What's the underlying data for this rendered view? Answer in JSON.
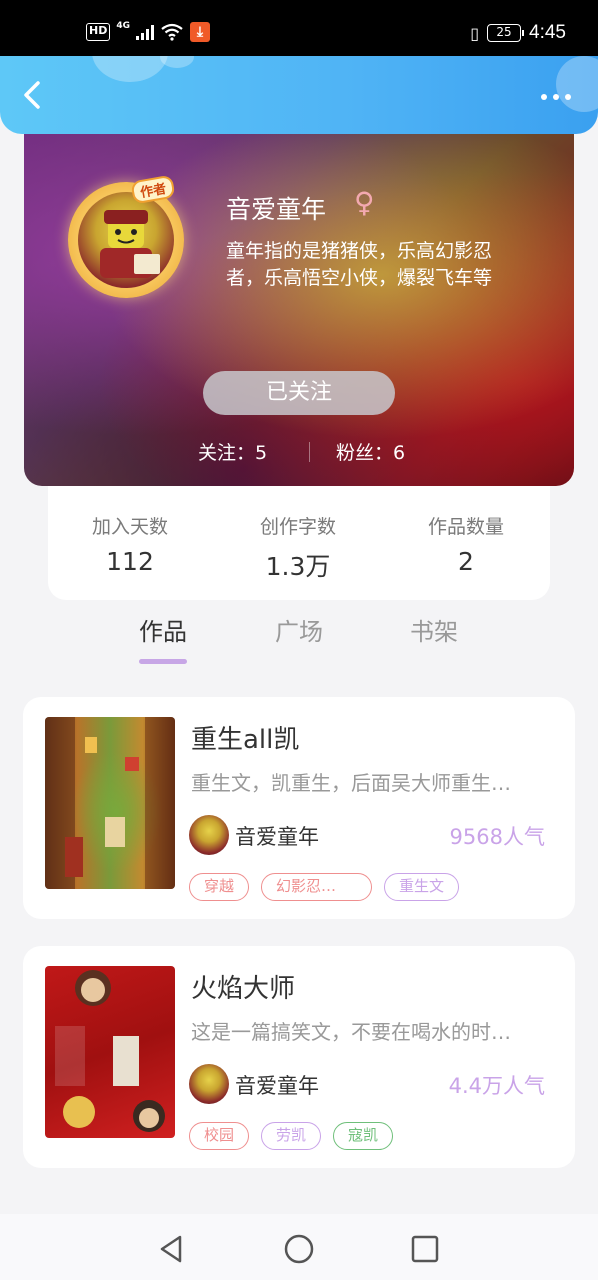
{
  "status_bar": {
    "hd": "HD",
    "network": "4G",
    "battery": "25",
    "time": "4:45",
    "icons": [
      "hd-icon",
      "signal-icon",
      "wifi-icon",
      "download-icon",
      "vibrate-icon",
      "battery-icon"
    ]
  },
  "header": {
    "back_icon": "back-arrow-icon",
    "more_icon": "more-dots-icon"
  },
  "profile": {
    "author_badge": "作者",
    "name": "音爱童年",
    "gender_symbol": "♀",
    "bio": "童年指的是猪猪侠，乐高幻影忍者，乐高悟空小侠，爆裂飞车等",
    "follow_button": "已关注",
    "following_label": "关注：",
    "following_count": "5",
    "fans_label": "粉丝：",
    "fans_count": "6"
  },
  "stats": [
    {
      "label": "加入天数",
      "value": "112"
    },
    {
      "label": "创作字数",
      "value": "1.3万"
    },
    {
      "label": "作品数量",
      "value": "2"
    }
  ],
  "tabs": [
    {
      "label": "作品",
      "active": true
    },
    {
      "label": "广场",
      "active": false
    },
    {
      "label": "书架",
      "active": false
    }
  ],
  "works": [
    {
      "title": "重生all凯",
      "desc": "重生文，凯重生，后面吴大师重生…",
      "author": "音爱童年",
      "popularity": "9568人气",
      "tags": [
        {
          "label": "穿越",
          "color": "#ef8f8f"
        },
        {
          "label": "幻影忍…",
          "color": "#ef8f8f"
        },
        {
          "label": "重生文",
          "color": "#c9a3e8"
        }
      ]
    },
    {
      "title": "火焰大师",
      "desc": "这是一篇搞笑文，不要在喝水的时…",
      "author": "音爱童年",
      "popularity": "4.4万人气",
      "tags": [
        {
          "label": "校园",
          "color": "#ef8f8f"
        },
        {
          "label": "劳凯",
          "color": "#c9a3e8"
        },
        {
          "label": "寇凯",
          "color": "#6fbf7a"
        }
      ]
    }
  ],
  "colors": {
    "header_blue": "#4fb3f5",
    "accent_purple": "#c9a3e8",
    "tab_underline": "#c7a6e6"
  }
}
